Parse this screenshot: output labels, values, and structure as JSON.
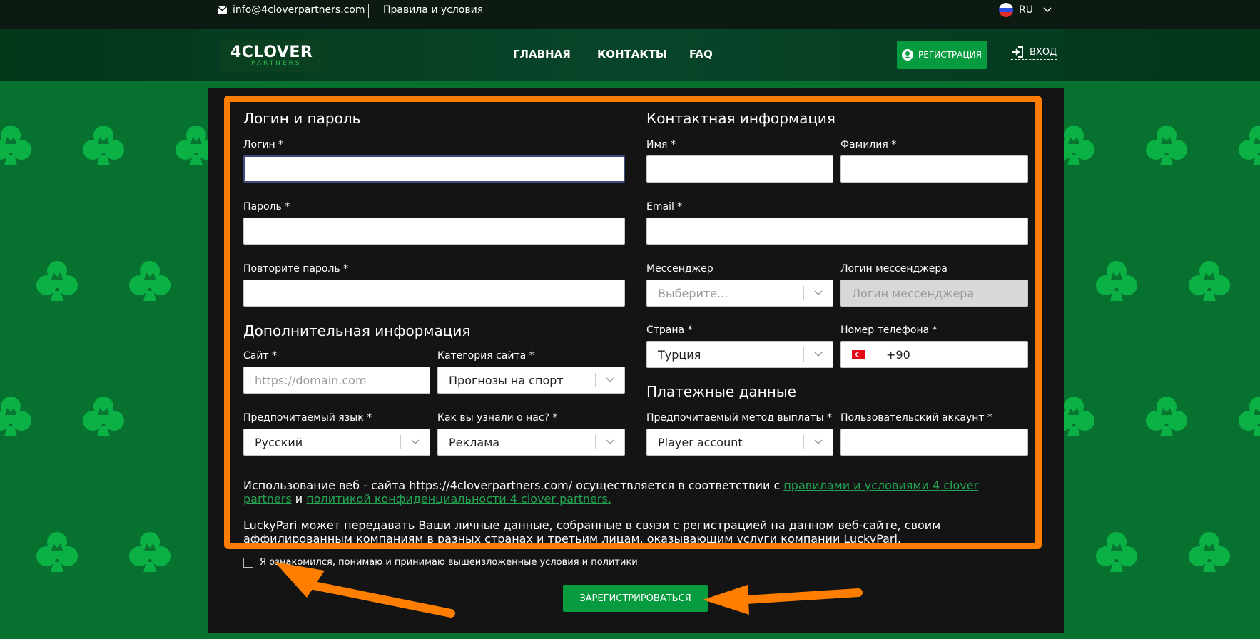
{
  "topbar": {
    "email": "info@4cloverpartners.com",
    "terms": "Правила и условия",
    "lang": "RU"
  },
  "header": {
    "logo_main": "4CLOVER",
    "logo_sub": "PARTNERS",
    "nav": [
      "ГЛАВНАЯ",
      "КОНТАКТЫ",
      "FAQ"
    ],
    "register": "РЕГИСТРАЦИЯ",
    "login": "ВХОД"
  },
  "form": {
    "login_section": "Логин и пароль",
    "login_label": "Логин *",
    "password_label": "Пароль *",
    "repeat_label": "Повторите пароль *",
    "extra_section": "Дополнительная информация",
    "site_label": "Сайт *",
    "site_placeholder": "https://domain.com",
    "site_category_label": "Категория сайта *",
    "site_category_value": "Прогнозы на спорт",
    "language_label": "Предпочитаемый язык *",
    "language_value": "Русский",
    "source_label": "Как вы узнали о нас? *",
    "source_value": "Реклама",
    "contact_section": "Контактная информация",
    "first_name_label": "Имя *",
    "last_name_label": "Фамилия *",
    "email_label": "Email *",
    "messenger_label": "Мессенджер",
    "messenger_placeholder": "Выберите...",
    "messenger_login_label": "Логин мессенджера",
    "messenger_login_placeholder": "Логин мессенджера",
    "country_label": "Страна *",
    "country_value": "Турция",
    "phone_label": "Номер телефона *",
    "phone_value": "+90",
    "payment_section": "Платежные данные",
    "payout_label": "Предпочитаемый метод выплаты *",
    "payout_value": "Player account",
    "account_label": "Пользовательский аккаунт *",
    "legal1_a": "Использование веб - сайта https://4cloverpartners.com/ осуществляется в соответствии с ",
    "legal1_link1": "правилами и условиями 4 clover partners",
    "legal1_b": " и ",
    "legal1_link2": "политикой конфиденциальности 4 clover partners.",
    "legal2": "LuckyPari может передавать Ваши личные данные, собранные в связи с регистрацией на данном веб-сайте, своим аффилированным компаниям в разных странах и третьим лицам, оказывающим услуги компании LuckyPari.",
    "agree": "Я ознакомился, понимаю и принимаю вышеизложенные условия и политики",
    "submit": "ЗАРЕГИСТРИРОВАТЬСЯ"
  },
  "colors": {
    "accent_green": "#069b3f",
    "highlight_orange": "#ff7e00",
    "panel": "#141414"
  }
}
